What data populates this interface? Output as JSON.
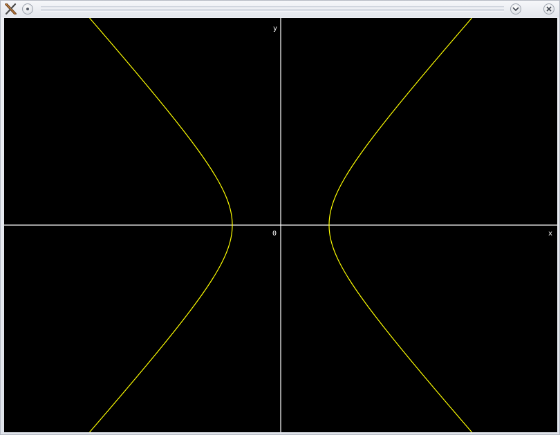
{
  "window": {
    "title": "",
    "icons": {
      "app": "x-window-icon",
      "menu": "window-menu-icon",
      "minimize": "chevron-down-icon",
      "close": "close-icon"
    }
  },
  "plot": {
    "background": "#000000",
    "axis_color": "#ffffff",
    "curve_color": "#ffff00",
    "labels": {
      "x": "x",
      "y": "y",
      "origin": "0"
    }
  }
}
